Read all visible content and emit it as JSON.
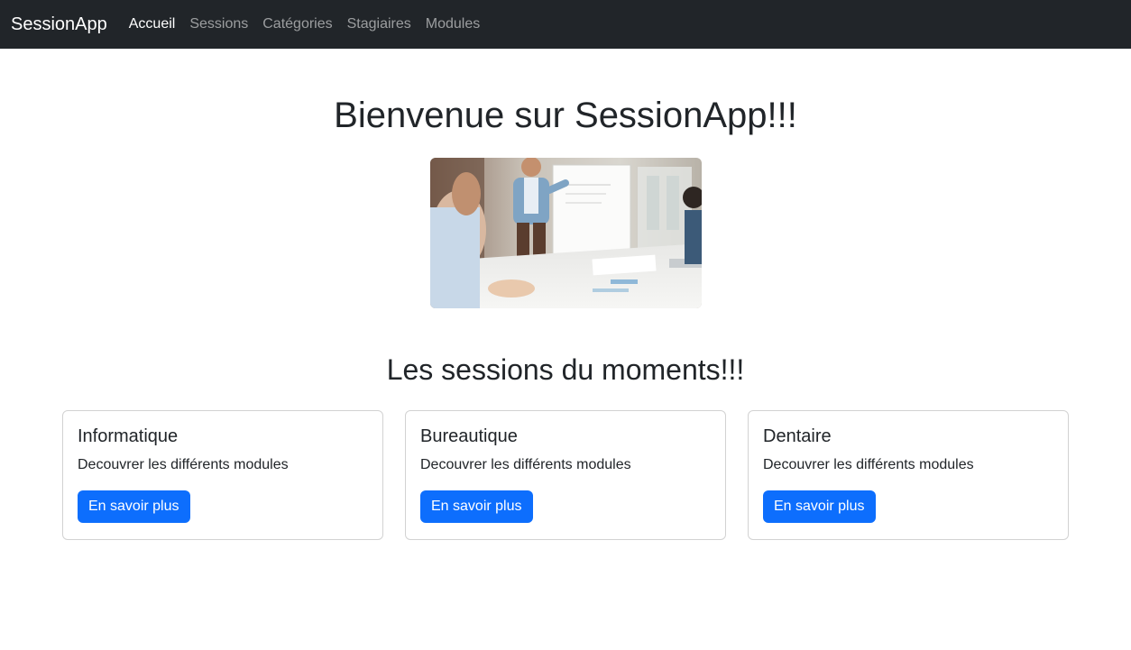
{
  "navbar": {
    "brand": "SessionApp",
    "links": [
      {
        "label": "Accueil",
        "active": true
      },
      {
        "label": "Sessions",
        "active": false
      },
      {
        "label": "Catégories",
        "active": false
      },
      {
        "label": "Stagiaires",
        "active": false
      },
      {
        "label": "Modules",
        "active": false
      }
    ]
  },
  "hero": {
    "title": "Bienvenue sur SessionApp!!!",
    "image_subject": "meeting-presentation-photo"
  },
  "sessions": {
    "title": "Les sessions du moments!!!",
    "cards": [
      {
        "title": "Informatique",
        "text": "Decouvrer les différents modules",
        "button": "En savoir plus"
      },
      {
        "title": "Bureautique",
        "text": "Decouvrer les différents modules",
        "button": "En savoir plus"
      },
      {
        "title": "Dentaire",
        "text": "Decouvrer les différents modules",
        "button": "En savoir plus"
      }
    ]
  },
  "colors": {
    "navbar_bg": "#212529",
    "primary": "#0d6efd",
    "text": "#212529"
  }
}
